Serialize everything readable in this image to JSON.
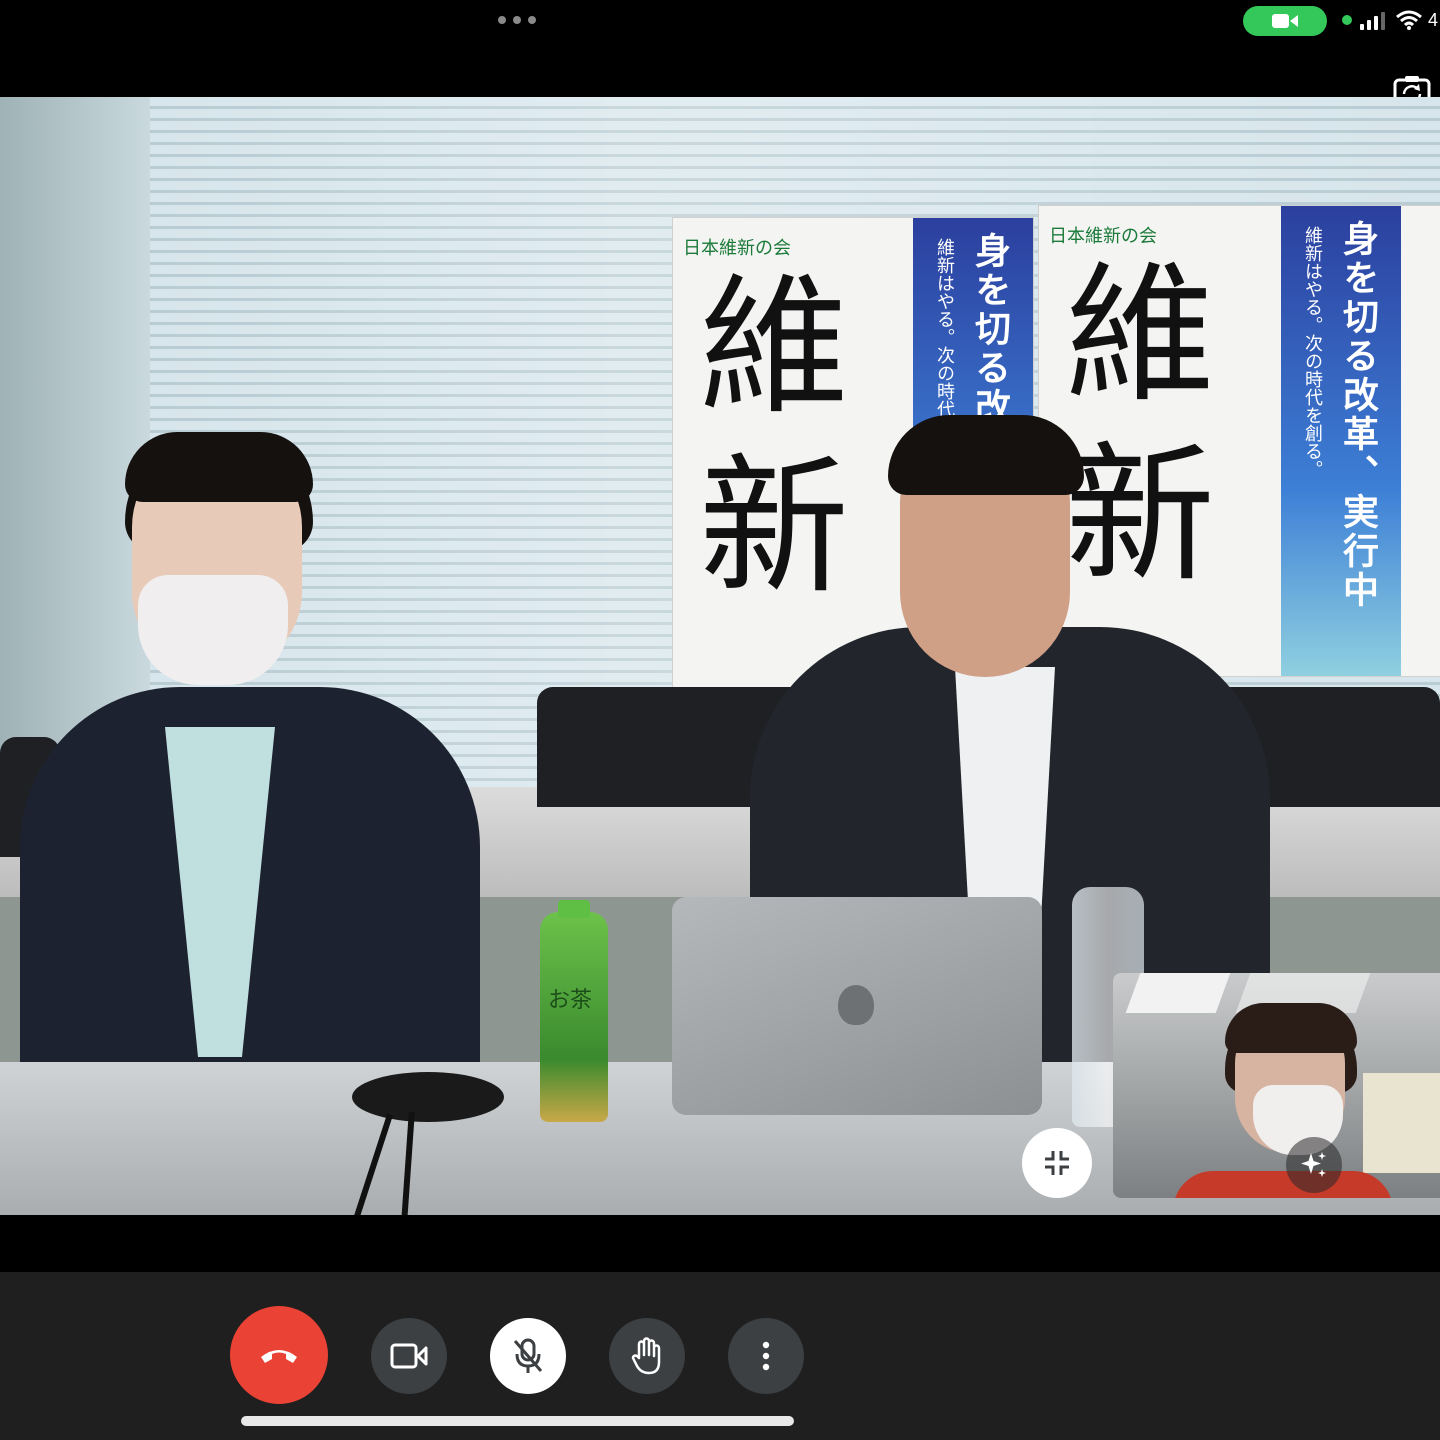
{
  "status_bar": {
    "battery_text": "4",
    "camera_pill_color": "#34c759",
    "icons": [
      "more-dots-icon",
      "video-camera-icon",
      "green-activity-dot-icon",
      "cellular-signal-icon",
      "wifi-icon"
    ]
  },
  "video": {
    "posters": [
      {
        "brand": "日本維新の会",
        "big_text": "維新",
        "vertical_headline": "身を切る改革、実行中",
        "vertical_sub": "維新はやる。次の時代を創る。"
      },
      {
        "brand": "日本維新の会",
        "big_text": "維新",
        "vertical_headline": "身を切る改革、実行中",
        "vertical_sub": "維新はやる。次の時代を創る。"
      }
    ],
    "tea_label": "お茶"
  },
  "self_view": {
    "effects_icon": "sparkle-icon"
  },
  "controls": {
    "end_call_color": "#ea4335",
    "buttons": [
      "end-call-button",
      "camera-toggle-button",
      "microphone-muted-button",
      "raise-hand-button",
      "more-options-button"
    ]
  }
}
